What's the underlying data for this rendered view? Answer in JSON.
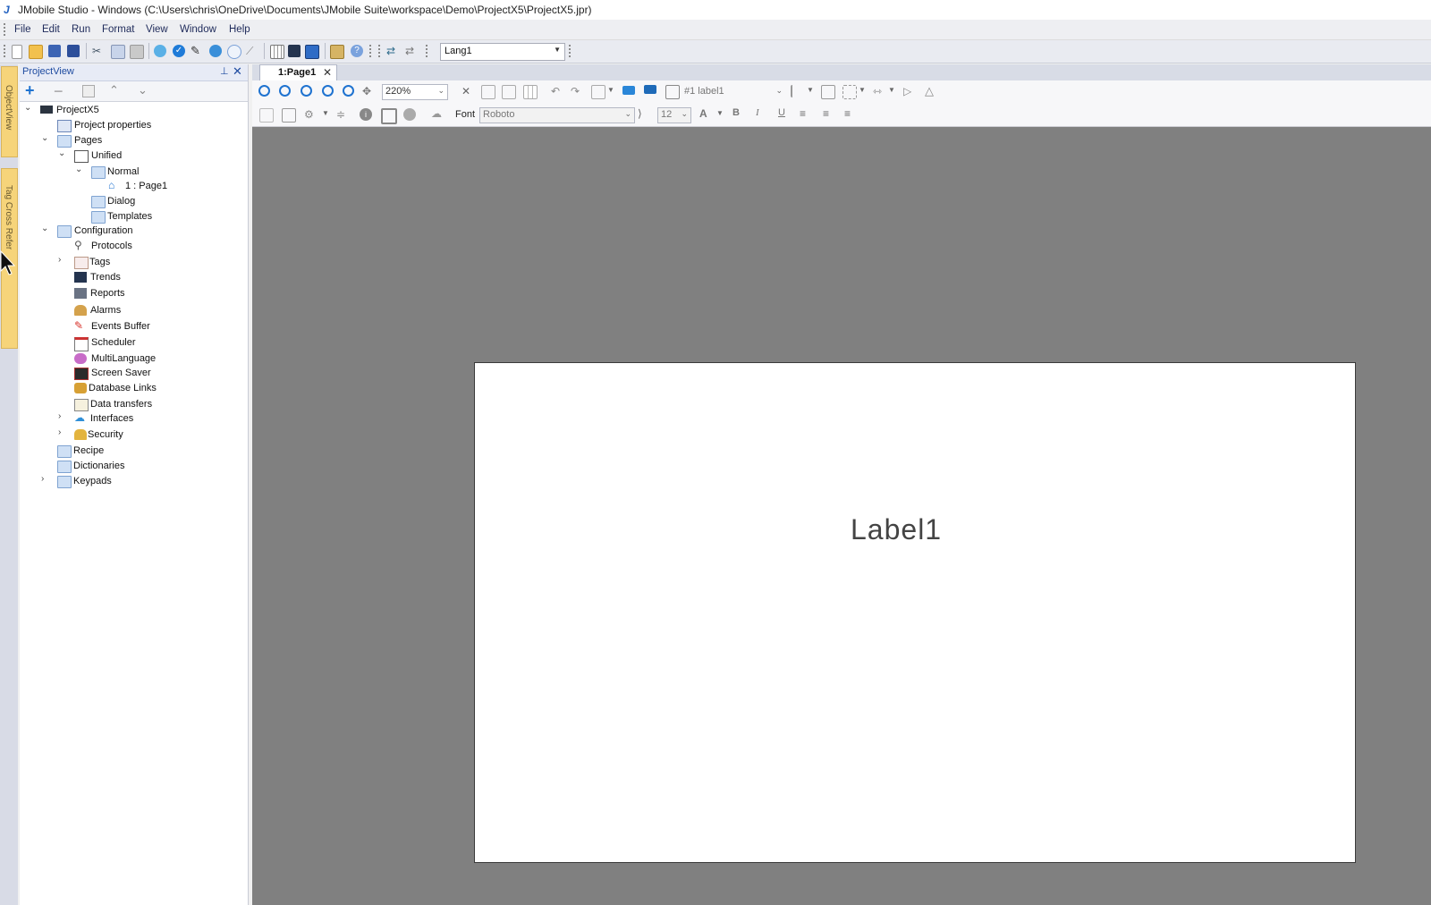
{
  "window": {
    "title": "JMobile Studio - Windows (C:\\Users\\chris\\OneDrive\\Documents\\JMobile Suite\\workspace\\Demo\\ProjectX5\\ProjectX5.jpr)",
    "app_icon": "J"
  },
  "menu": [
    "File",
    "Edit",
    "Run",
    "Format",
    "View",
    "Window",
    "Help"
  ],
  "toolbar": {
    "language": "Lang1"
  },
  "side_tabs": [
    "ObjectView",
    "Tag Cross Refer"
  ],
  "project_view": {
    "title": "ProjectView",
    "tree": {
      "root": "ProjectX5",
      "project_properties": "Project properties",
      "pages": "Pages",
      "unified": "Unified",
      "normal": "Normal",
      "page1": "1 : Page1",
      "dialog": "Dialog",
      "templates": "Templates",
      "configuration": "Configuration",
      "protocols": "Protocols",
      "tags": "Tags",
      "trends": "Trends",
      "reports": "Reports",
      "alarms": "Alarms",
      "events_buffer": "Events Buffer",
      "scheduler": "Scheduler",
      "multilanguage": "MultiLanguage",
      "screen_saver": "Screen Saver",
      "database_links": "Database Links",
      "data_transfers": "Data transfers",
      "interfaces": "Interfaces",
      "security": "Security",
      "recipe": "Recipe",
      "dictionaries": "Dictionaries",
      "keypads": "Keypads"
    }
  },
  "editor": {
    "tab_label": "1:Page1",
    "zoom": "220%",
    "widget_select": "#1 label1",
    "font_label": "Font",
    "font_name": "Roboto",
    "font_size": "12",
    "canvas_label": "Label1"
  },
  "colors": {
    "accent": "#1e4ba0",
    "canvas_bg": "#808080",
    "side_tab": "#f6d47a"
  }
}
